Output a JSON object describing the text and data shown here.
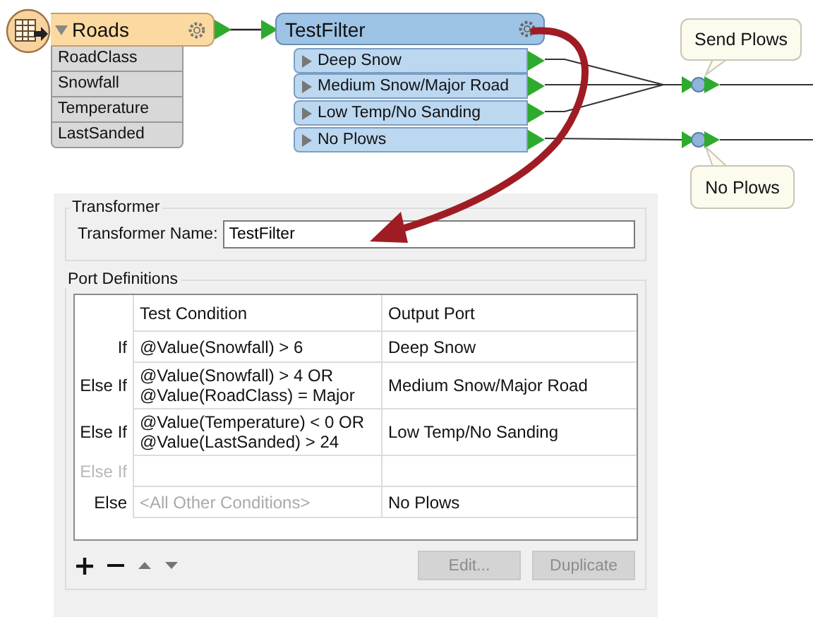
{
  "canvas": {
    "reader": {
      "name": "Roads",
      "attributes": [
        "RoadClass",
        "Snowfall",
        "Temperature",
        "LastSanded"
      ]
    },
    "transformer": {
      "name": "TestFilter",
      "ports": [
        "Deep Snow",
        "Medium Snow/Major Road",
        "Low Temp/No Sanding",
        "No Plows"
      ]
    },
    "outputs": [
      {
        "label": "Send Plows"
      },
      {
        "label": "No Plows"
      }
    ]
  },
  "dialog": {
    "transformer_group": {
      "title": "Transformer",
      "name_label": "Transformer Name:",
      "name_value": "TestFilter"
    },
    "port_definitions": {
      "title": "Port Definitions",
      "columns": [
        "Test Condition",
        "Output Port"
      ],
      "rows": [
        {
          "kind": "condition",
          "keyword": "If",
          "condition": [
            "@Value(Snowfall) > 6"
          ],
          "output": "Deep Snow"
        },
        {
          "kind": "condition",
          "keyword": "Else If",
          "condition": [
            "@Value(Snowfall) > 4 OR",
            "@Value(RoadClass) = Major"
          ],
          "output": "Medium Snow/Major Road"
        },
        {
          "kind": "condition",
          "keyword": "Else If",
          "condition": [
            "@Value(Temperature) < 0 OR",
            "@Value(LastSanded) > 24"
          ],
          "output": "Low Temp/No Sanding"
        },
        {
          "kind": "empty",
          "keyword": "Else If"
        },
        {
          "kind": "default",
          "keyword": "Else",
          "condition": [
            "<All Other Conditions>"
          ],
          "output": "No Plows"
        }
      ],
      "tools": [
        {
          "kind": "add",
          "disabled": false
        },
        {
          "kind": "remove",
          "disabled": false
        },
        {
          "kind": "up",
          "disabled": true
        },
        {
          "kind": "down",
          "disabled": true
        }
      ],
      "buttons": [
        {
          "label": "Edit...",
          "disabled": true
        },
        {
          "label": "Duplicate",
          "disabled": true
        }
      ]
    }
  }
}
